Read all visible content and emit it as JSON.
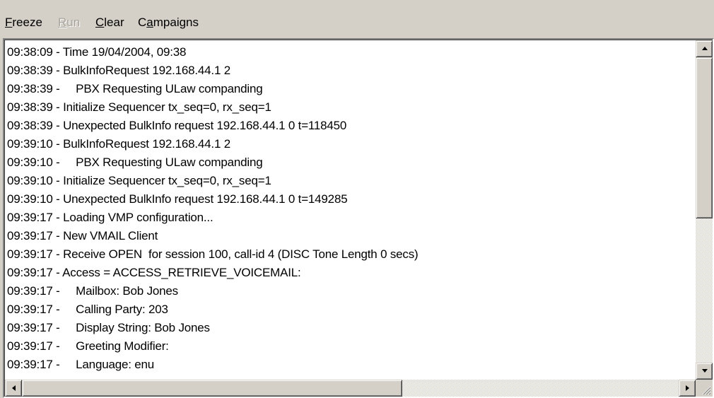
{
  "menu": {
    "freeze": {
      "mnemonic": "F",
      "rest": "reeze"
    },
    "run": {
      "mnemonic": "R",
      "rest": "un"
    },
    "clear": {
      "mnemonic": "C",
      "rest": "lear"
    },
    "campaigns": {
      "pre": "C",
      "mnemonic": "a",
      "rest": "mpaigns"
    }
  },
  "log": {
    "lines": [
      "09:38:09 - Time 19/04/2004, 09:38",
      "09:38:39 - BulkInfoRequest 192.168.44.1 2",
      "09:38:39 -     PBX Requesting ULaw companding",
      "09:38:39 - Initialize Sequencer tx_seq=0, rx_seq=1",
      "09:38:39 - Unexpected BulkInfo request 192.168.44.1 0 t=118450",
      "09:39:10 - BulkInfoRequest 192.168.44.1 2",
      "09:39:10 -     PBX Requesting ULaw companding",
      "09:39:10 - Initialize Sequencer tx_seq=0, rx_seq=1",
      "09:39:10 - Unexpected BulkInfo request 192.168.44.1 0 t=149285",
      "09:39:17 - Loading VMP configuration...",
      "09:39:17 - New VMAIL Client",
      "09:39:17 - Receive OPEN  for session 100, call-id 4 (DISC Tone Length 0 secs)",
      "09:39:17 - Access = ACCESS_RETRIEVE_VOICEMAIL:",
      "09:39:17 -     Mailbox: Bob Jones",
      "09:39:17 -     Calling Party: 203",
      "09:39:17 -     Display String: Bob Jones",
      "09:39:17 -     Greeting Modifier:",
      "09:39:17 -     Language: enu"
    ]
  },
  "scroll": {
    "vertical_position": 0.0,
    "horizontal_position": 0.0
  },
  "icons": {
    "up": "arrow-up-icon",
    "down": "arrow-down-icon",
    "left": "arrow-left-icon",
    "right": "arrow-right-icon",
    "grip": "size-grip-icon"
  }
}
